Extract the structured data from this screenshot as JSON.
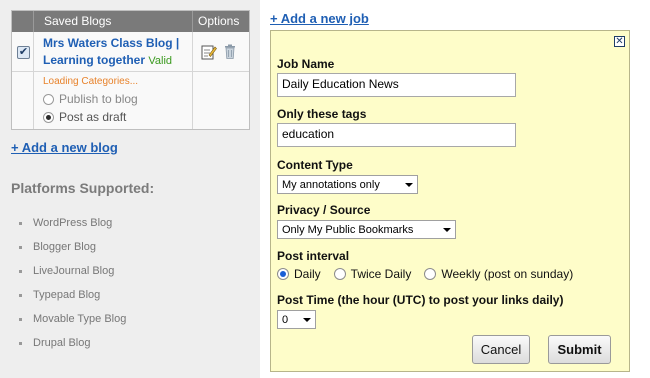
{
  "saved_blogs": {
    "header_title": "Saved Blogs",
    "header_options": "Options",
    "blog": {
      "checked": true,
      "title": "Mrs Waters Class Blog | Learning together",
      "status": "Valid"
    },
    "loading_text": "Loading Categories...",
    "publish_label": "Publish to blog",
    "draft_label": "Post as draft",
    "selected_option": "Post as draft"
  },
  "add_blog_link": "+ Add a new blog",
  "platforms": {
    "title": "Platforms Supported:",
    "items": [
      "WordPress Blog",
      "Blogger Blog",
      "LiveJournal Blog",
      "Typepad Blog",
      "Movable Type Blog",
      "Drupal Blog"
    ]
  },
  "add_job_link": "+ Add a new job",
  "job_form": {
    "close_glyph": "✕",
    "job_name_label": "Job Name",
    "job_name_value": "Daily Education News",
    "tags_label": "Only these tags",
    "tags_value": "education",
    "content_type_label": "Content Type",
    "content_type_value": "My annotations only",
    "privacy_label": "Privacy / Source",
    "privacy_value": "Only My Public Bookmarks",
    "interval_label": "Post interval",
    "interval_options": [
      "Daily",
      "Twice Daily",
      "Weekly (post on sunday)"
    ],
    "interval_selected": "Daily",
    "post_time_label": "Post Time (the hour (UTC) to post your links daily)",
    "post_time_value": "0",
    "cancel_label": "Cancel",
    "submit_label": "Submit"
  },
  "colors": {
    "link": "#1f5fb4",
    "valid": "#3a9a1e",
    "loading": "#e8822a",
    "form_bg": "#fefdc9",
    "header_bg": "#7a7a7a"
  }
}
